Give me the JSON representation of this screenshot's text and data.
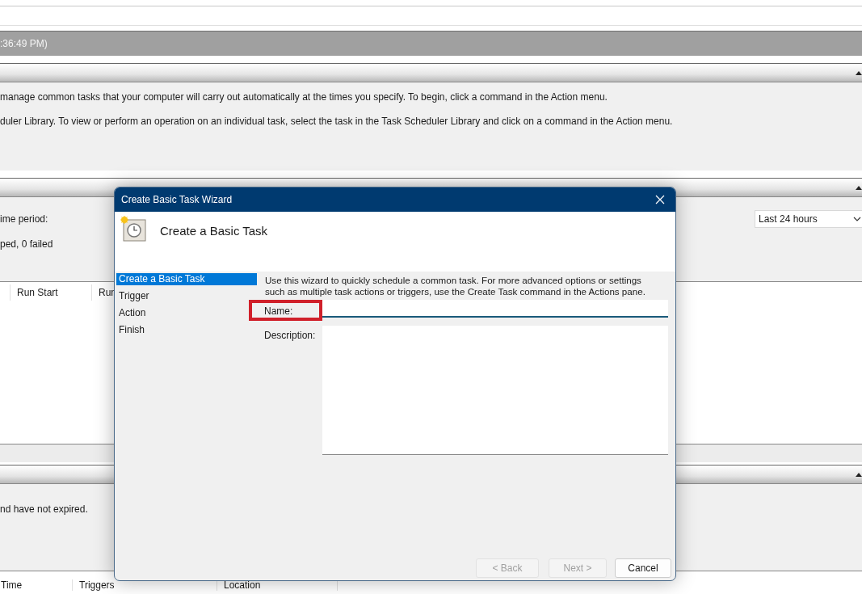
{
  "window": {
    "timestamp_fragment": ":36:49 PM)"
  },
  "overview_section": {
    "lines": [
      "manage common tasks that your computer will carry out automatically at the times you specify. To begin, click a command in the Action menu.",
      "duler Library. To view or perform an operation on an individual task, select the task in the Task Scheduler Library and click on a command in the Action menu."
    ]
  },
  "status_section": {
    "period_label": "ime period:",
    "summary": "ped, 0 failed",
    "range_dropdown": {
      "value": "Last 24 hours"
    },
    "table": {
      "columns": [
        "Run Start",
        "Run"
      ]
    }
  },
  "active_section": {
    "text": "nd have not expired.",
    "table": {
      "columns": [
        "Time",
        "Triggers",
        "Location"
      ]
    }
  },
  "dialog": {
    "title": "Create Basic Task Wizard",
    "header_title": "Create a Basic Task",
    "steps": [
      {
        "label": "Create a Basic Task",
        "selected": true
      },
      {
        "label": "Trigger",
        "selected": false
      },
      {
        "label": "Action",
        "selected": false
      },
      {
        "label": "Finish",
        "selected": false
      }
    ],
    "intro": "Use this wizard to quickly schedule a common task.  For more advanced options or settings such as multiple task actions or triggers, use the Create Task command in the Actions pane.",
    "fields": [
      {
        "kind": "line",
        "label": "Name:",
        "highlighted": true,
        "focused": true
      },
      {
        "kind": "area",
        "label": "Description:",
        "highlighted": false,
        "focused": false
      }
    ],
    "buttons": [
      {
        "label": "< Back",
        "disabled": true
      },
      {
        "label": "Next >",
        "disabled": true
      },
      {
        "label": "Cancel",
        "disabled": false
      }
    ]
  }
}
